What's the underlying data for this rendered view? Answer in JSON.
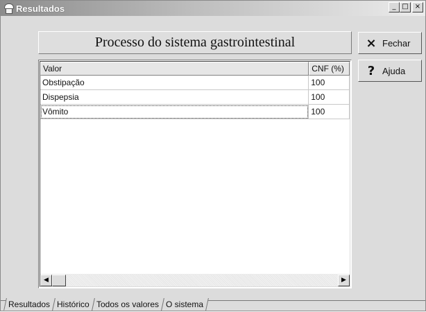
{
  "window": {
    "title": "Resultados",
    "minimize": "_",
    "maximize": "□",
    "close": "×"
  },
  "header": {
    "title": "Processo do sistema gastrointestinal"
  },
  "buttons": {
    "fechar": {
      "label": "Fechar",
      "icon": "×",
      "icon_name": "close-x-icon"
    },
    "ajuda": {
      "label": "Ajuda",
      "icon": "?",
      "icon_name": "help-question-icon"
    }
  },
  "table": {
    "columns": [
      "Valor",
      "CNF (%)"
    ],
    "rows": [
      {
        "valor": "Obstipação",
        "cnf": "100"
      },
      {
        "valor": "Dispepsia",
        "cnf": "100"
      },
      {
        "valor": "Vômito",
        "cnf": "100"
      }
    ],
    "selected_row": 2
  },
  "scrollbar": {
    "left_arrow": "◀",
    "right_arrow": "▶"
  },
  "tabs": [
    "Resultados",
    "Histórico",
    "Todos os valores",
    "O sistema"
  ],
  "active_tab": 0
}
